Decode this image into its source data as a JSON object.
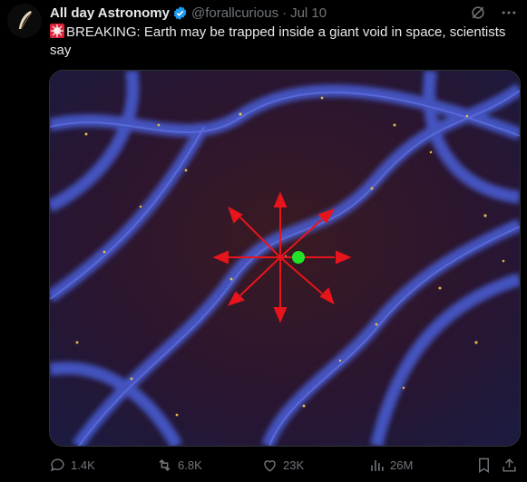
{
  "tweet": {
    "author_name": "All day Astronomy",
    "handle": "@forallcurious",
    "separator": "·",
    "date": "Jul 10",
    "text": "BREAKING: Earth may be trapped inside a giant void in space, scientists say",
    "emoji_icon": "siren-icon"
  },
  "media": {
    "description_icons": [
      "cosmic-web-image",
      "arrows-outward",
      "earth-marker"
    ],
    "colors": {
      "arrows": "#e8141c",
      "marker": "#21e32a",
      "filament": "#4a5fd8",
      "void": "#3a1a22"
    }
  },
  "actions": {
    "replies": "1.4K",
    "reposts": "6.8K",
    "likes": "23K",
    "views": "26M"
  }
}
